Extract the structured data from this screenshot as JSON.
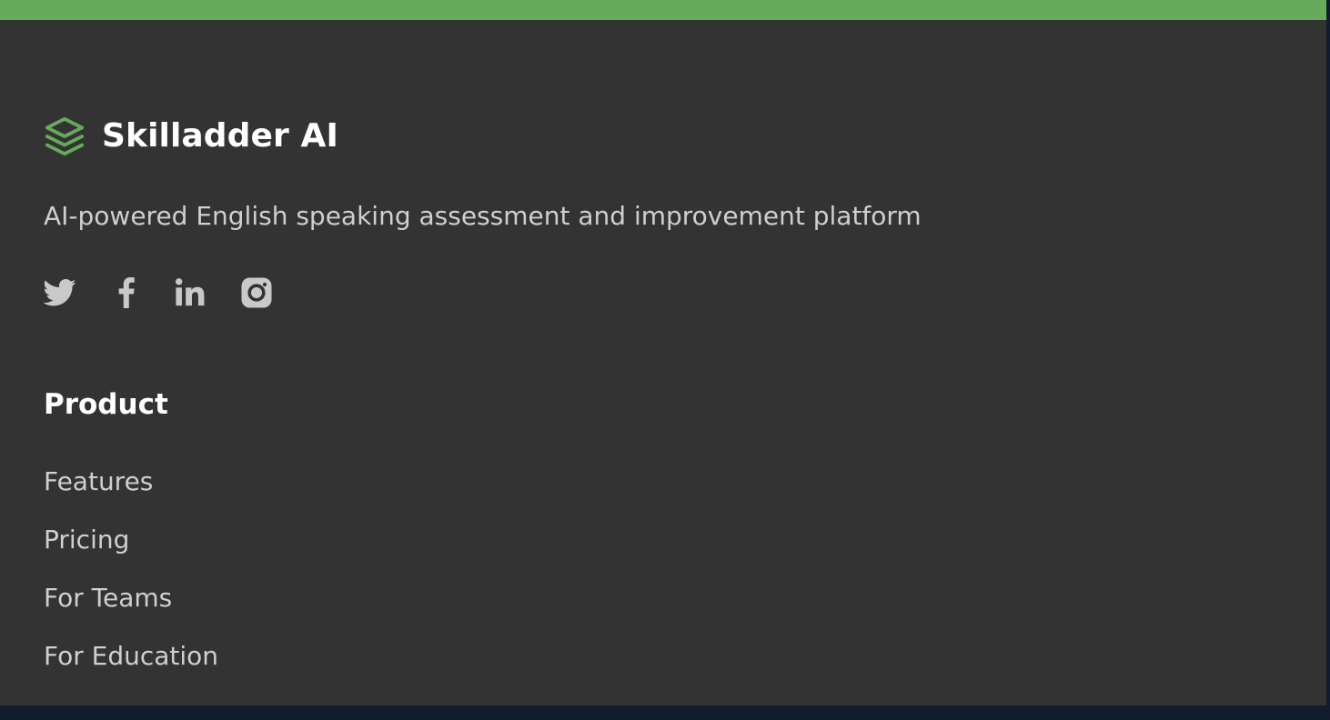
{
  "theme": {
    "background": "#333333",
    "accent": "#66ab5b",
    "text_primary": "#ffffff",
    "text_secondary": "#cfcfcf",
    "icon_color": "#c9c9c9",
    "page_edge": "#131c2e"
  },
  "brand": {
    "icon": "layers-icon",
    "name": "Skilladder AI",
    "tagline": "AI-powered English speaking assessment and improvement platform"
  },
  "socials": [
    {
      "icon": "twitter-icon",
      "label": "Twitter"
    },
    {
      "icon": "facebook-icon",
      "label": "Facebook"
    },
    {
      "icon": "linkedin-icon",
      "label": "LinkedIn"
    },
    {
      "icon": "instagram-icon",
      "label": "Instagram"
    }
  ],
  "product": {
    "heading": "Product",
    "links": [
      {
        "label": "Features"
      },
      {
        "label": "Pricing"
      },
      {
        "label": "For Teams"
      },
      {
        "label": "For Education"
      }
    ]
  }
}
